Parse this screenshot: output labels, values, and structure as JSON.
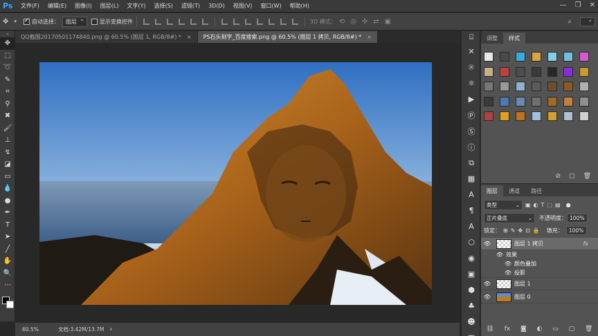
{
  "app": {
    "logo": "Ps"
  },
  "menu": [
    "文件(F)",
    "编辑(E)",
    "图像(I)",
    "图层(L)",
    "文字(Y)",
    "选择(S)",
    "滤镜(T)",
    "3D(D)",
    "视图(V)",
    "窗口(W)",
    "帮助(H)"
  ],
  "window_controls": {
    "minimize": "—",
    "restore": "❐",
    "close": "✕"
  },
  "options": {
    "auto_select_label": "自动选择：",
    "auto_select_value": "图层",
    "show_transform_label": "显示变换控件",
    "mode_3d_label": "3D 模式："
  },
  "tabs": [
    {
      "label": "QQ截图20170501174840.png @ 60.5% (图层 1, RGB/8#) *",
      "close": "×"
    },
    {
      "label": "PS石头刻字_百度搜索.png @ 60.5% (图层 1 拷贝, RGB/8#) *",
      "close": "×"
    }
  ],
  "status": {
    "zoom": "60.5%",
    "doc_info": "文档:3.42M/13.7M",
    "arrow": "›"
  },
  "styles_panel": {
    "tabs": [
      "调整",
      "样式"
    ],
    "swatch_colors": [
      "#e8e8e8",
      "#4a4a4a",
      "#3aa9e0",
      "#d9a441",
      "#7fd0e8",
      "#6fc0e0",
      "#d55ad0",
      "#c8b08a",
      "#c04040",
      "#4d4d4d",
      "#3a3a3a",
      "#282828",
      "#8a2be2",
      "#c89a30",
      "#777777",
      "#9a9a9a",
      "#8fb0d0",
      "#5a5a5a",
      "#6b5030",
      "#8a5a20",
      "#b0b0b0",
      "#3a3a3a",
      "#4a7ab0",
      "#6a8ab0",
      "#707070",
      "#a06a20",
      "#c08040",
      "#909090",
      "#b04040",
      "#e0a020",
      "#c07020",
      "#a0c0e0",
      "#d0a030",
      "#b0c0d0",
      "#d0d0d0"
    ]
  },
  "layers_panel": {
    "tabs": [
      "图层",
      "通道",
      "路径"
    ],
    "filter_kind": "类型",
    "blend_mode": "正片叠底",
    "opacity_label": "不透明度：",
    "opacity_value": "100%",
    "lock_label": "锁定：",
    "fill_label": "填充：",
    "fill_value": "100%",
    "layers": [
      {
        "name": "图层 1 拷贝",
        "selected": true,
        "fx": "fx"
      },
      {
        "name": "效果",
        "effect": true
      },
      {
        "name": "颜色叠加",
        "effect": true
      },
      {
        "name": "投影",
        "effect": true
      },
      {
        "name": "图层 1"
      },
      {
        "name": "图层 0"
      }
    ]
  },
  "colors": {
    "ps_blue": "#31a8ff",
    "sky_top": "#3a7ac8",
    "rock": "#c07a20"
  }
}
